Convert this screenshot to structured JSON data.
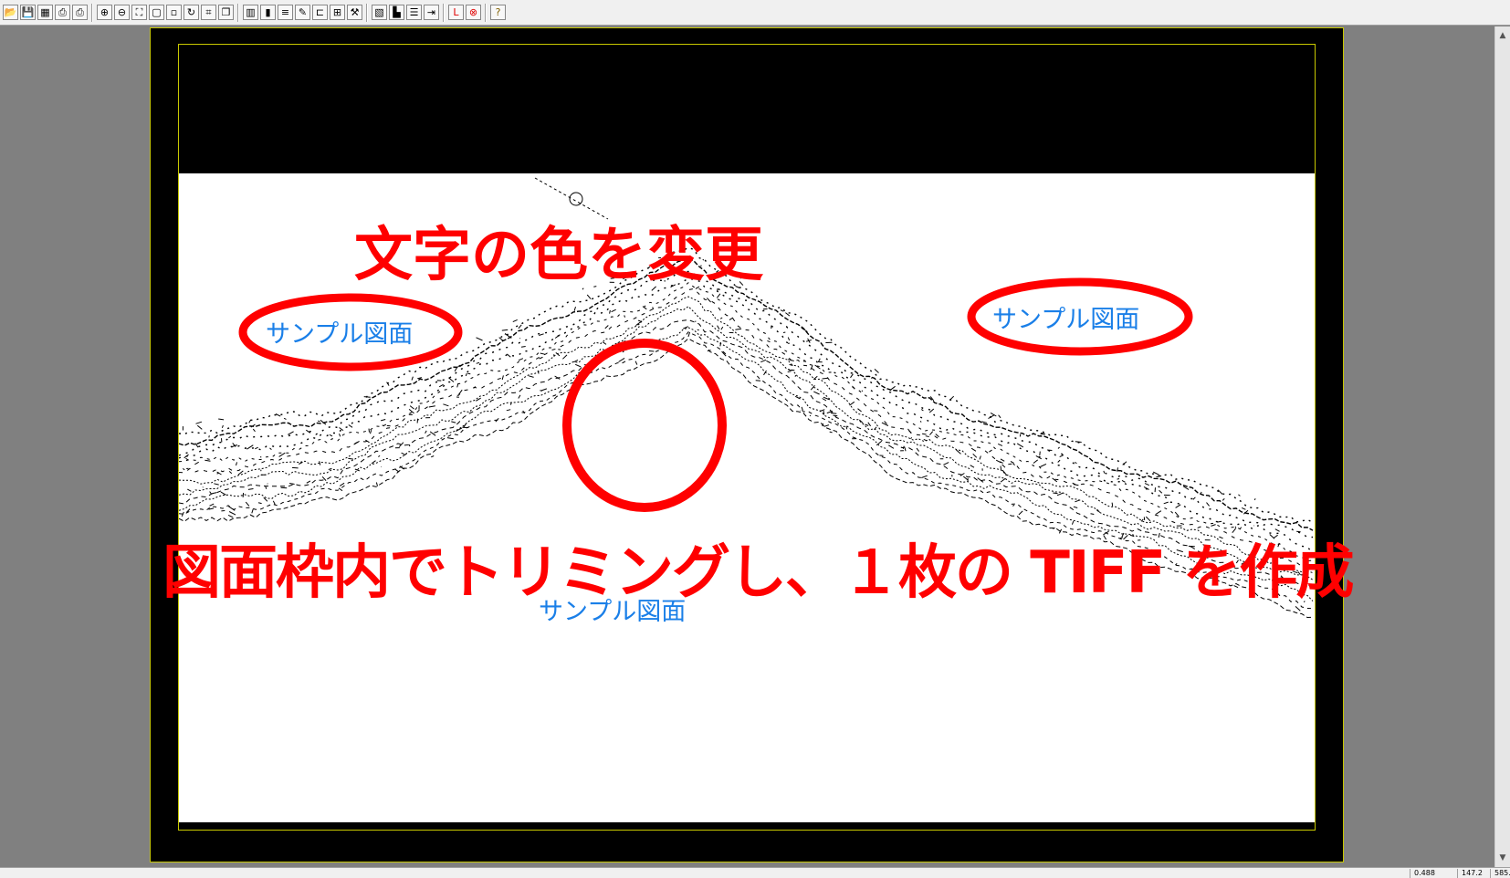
{
  "toolbar": {
    "buttons": [
      {
        "name": "open-icon",
        "glyph": "📂"
      },
      {
        "name": "save-icon",
        "glyph": "💾"
      },
      {
        "name": "scan-icon",
        "glyph": "▦"
      },
      {
        "name": "print-icon",
        "glyph": "⎙"
      },
      {
        "name": "print-preview-icon",
        "glyph": "⎙"
      },
      {
        "name": "zoom-in-icon",
        "glyph": "⊕"
      },
      {
        "name": "zoom-out-icon",
        "glyph": "⊖"
      },
      {
        "name": "zoom-fit-icon",
        "glyph": "⛶"
      },
      {
        "name": "zoom-page-icon",
        "glyph": "▢"
      },
      {
        "name": "zoom-area-icon",
        "glyph": "▫"
      },
      {
        "name": "rotate-icon",
        "glyph": "↻"
      },
      {
        "name": "trim-icon",
        "glyph": "⌗"
      },
      {
        "name": "copy-icon",
        "glyph": "❐"
      },
      {
        "name": "grid-icon",
        "glyph": "▥"
      },
      {
        "name": "color-bars-icon",
        "glyph": "▮"
      },
      {
        "name": "layers-icon",
        "glyph": "≡"
      },
      {
        "name": "edit-icon",
        "glyph": "✎"
      },
      {
        "name": "align-icon",
        "glyph": "⊏"
      },
      {
        "name": "merge-icon",
        "glyph": "⊞"
      },
      {
        "name": "tool-icon",
        "glyph": "⚒"
      },
      {
        "name": "image-icon",
        "glyph": "▧"
      },
      {
        "name": "chart-icon",
        "glyph": "▙"
      },
      {
        "name": "list-icon",
        "glyph": "☰"
      },
      {
        "name": "arrow-icon",
        "glyph": "⇥"
      },
      {
        "name": "red-mark-icon",
        "glyph": "L"
      },
      {
        "name": "delete-icon",
        "glyph": "⊗"
      },
      {
        "name": "help-icon",
        "glyph": "?"
      }
    ]
  },
  "annotations": {
    "color_change": "文字の色を変更",
    "trim_note": "図面枠内でトリミングし、１枚の TIFF を作成"
  },
  "labels": {
    "sample_left": "サンプル図面",
    "sample_right": "サンプル図面",
    "sample_bottom": "サンプル図面"
  },
  "status": {
    "cell1": "0.488",
    "cell2": "147.2",
    "cell3": "585.3"
  },
  "colors": {
    "annotation_red": "#ff0000",
    "label_blue": "#1a7fe8",
    "frame_yellow": "#c8c800"
  }
}
